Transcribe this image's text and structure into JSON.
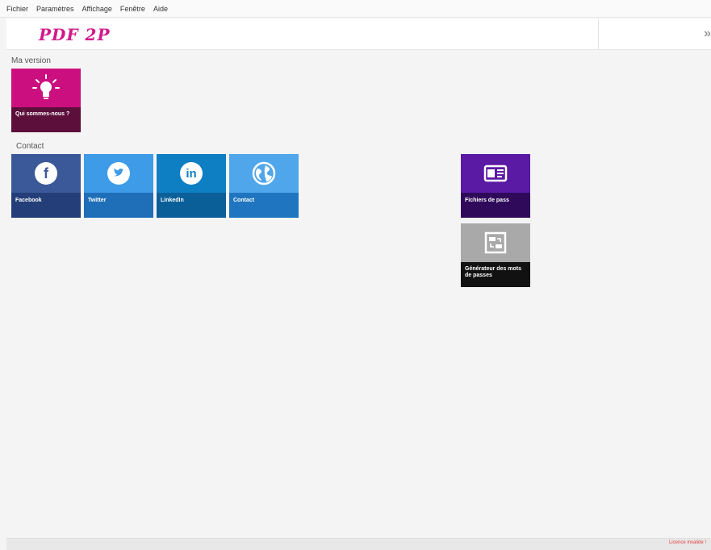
{
  "menu": [
    "Fichier",
    "Paramètres",
    "Affichage",
    "Fenêtre",
    "Aide"
  ],
  "brand": {
    "logo_text": "PDF 2P",
    "collapse_glyph": "»"
  },
  "sections": {
    "version": "Ma version",
    "contact": "Contact"
  },
  "tiles": {
    "about": {
      "label": "Qui sommes-nous ?",
      "icon": "lightbulb-icon",
      "color": "#cc0f7f"
    },
    "facebook": {
      "label": "Facebook",
      "icon": "facebook-icon",
      "color": "#3b5998"
    },
    "twitter": {
      "label": "Twitter",
      "icon": "twitter-icon",
      "color": "#3e9be8"
    },
    "linkedin": {
      "label": "LinkedIn",
      "icon": "linkedin-icon",
      "color": "#0f7fc4"
    },
    "contact": {
      "label": "Contact",
      "icon": "globe-icon",
      "color": "#4fa6ea"
    },
    "data": {
      "label": "Fichiers de pass",
      "icon": "id-card-icon",
      "color": "#5a1aa4"
    },
    "password": {
      "label": "Générateur des mots de passes",
      "icon": "swap-icon",
      "color": "#a9a9a9"
    }
  },
  "status": {
    "text": "Licence invalide !"
  },
  "accent": "#d2198a"
}
